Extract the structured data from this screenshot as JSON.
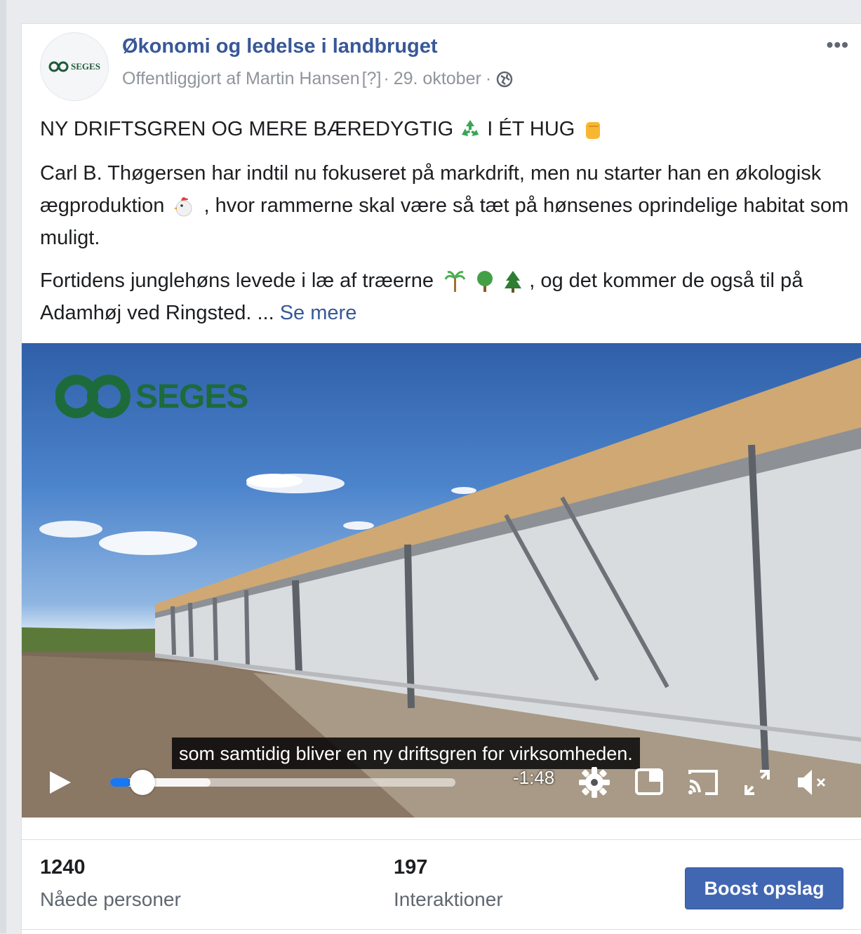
{
  "post": {
    "page_name": "Økonomi og ledelse i landbruget",
    "avatar_logo_text": "SEGES",
    "published_prefix": "Offentliggjort af Martin Hansen",
    "published_marker": "[?]",
    "separator": "·",
    "date": "29. oktober",
    "more_label": "•••",
    "headline_part1": "NY DRIFTSGREN OG MERE BÆREDYGTIG",
    "headline_part2": "I ÉT HUG",
    "paragraph1": {
      "part1": "Carl B. Thøgersen har indtil nu fokuseret på markdrift, men nu starter han en økologisk ægproduktion",
      "part2": ", hvor rammerne skal være så tæt på hønsenes oprindelige habitat som muligt."
    },
    "paragraph2": {
      "part1": "Fortidens junglehøns levede i læ af træerne",
      "part2": ", og det kommer de også til på Adamhøj ved Ringsted. ...",
      "see_more": "Se mere"
    }
  },
  "video": {
    "logo_text": "SEGES",
    "caption": "som samtidig bliver en ny driftsgren for virksomheden.",
    "time_remaining": "-1:48",
    "progress_fraction": 0.06,
    "buffered_fraction": 0.29
  },
  "stats": {
    "reach_value": "1240",
    "reach_label": "Nåede personer",
    "interactions_value": "197",
    "interactions_label": "Interaktioner",
    "boost_label": "Boost opslag"
  },
  "colors": {
    "link": "#385898",
    "boost_button": "#4267b2",
    "progress": "#1877f2"
  }
}
